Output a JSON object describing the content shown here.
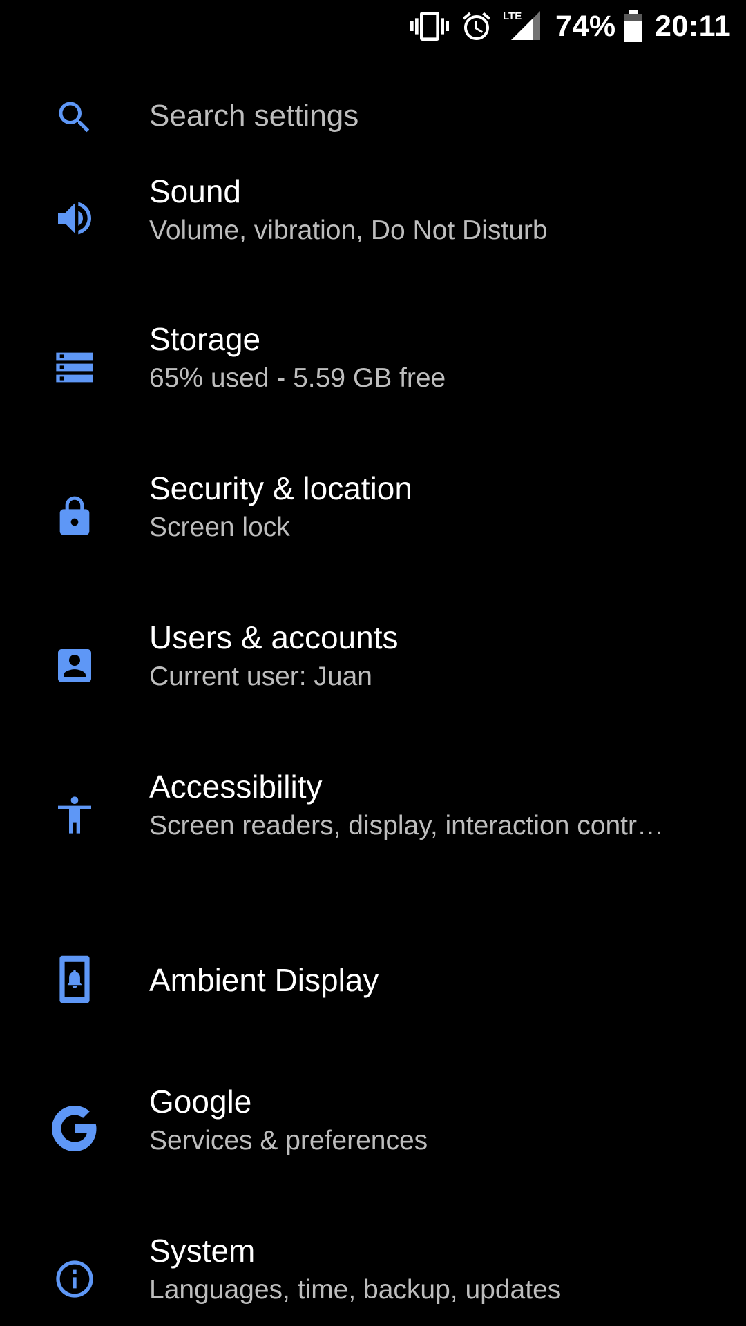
{
  "status_bar": {
    "icons": [
      "vibrate-icon",
      "alarm-icon",
      "lte-signal-icon",
      "battery-icon"
    ],
    "network_label": "LTE",
    "battery_percent": "74%",
    "battery_level": 0.74,
    "time": "20:11"
  },
  "search": {
    "placeholder": "Search settings",
    "icon": "search-icon"
  },
  "accent_color": "#5e97f6",
  "settings": [
    {
      "icon": "volume-icon",
      "title": "Sound",
      "summary": "Volume, vibration, Do Not Disturb"
    },
    {
      "icon": "storage-icon",
      "title": "Storage",
      "summary": "65% used - 5.59 GB free"
    },
    {
      "icon": "lock-icon",
      "title": "Security & location",
      "summary": "Screen lock"
    },
    {
      "icon": "account-box-icon",
      "title": "Users & accounts",
      "summary": "Current user: Juan"
    },
    {
      "icon": "accessibility-icon",
      "title": "Accessibility",
      "summary": "Screen readers, display, interaction contr…"
    },
    {
      "icon": "ambient-display-icon",
      "title": "Ambient Display",
      "summary": ""
    },
    {
      "icon": "google-icon",
      "title": "Google",
      "summary": "Services & preferences"
    },
    {
      "icon": "info-icon",
      "title": "System",
      "summary": "Languages, time, backup, updates"
    }
  ]
}
